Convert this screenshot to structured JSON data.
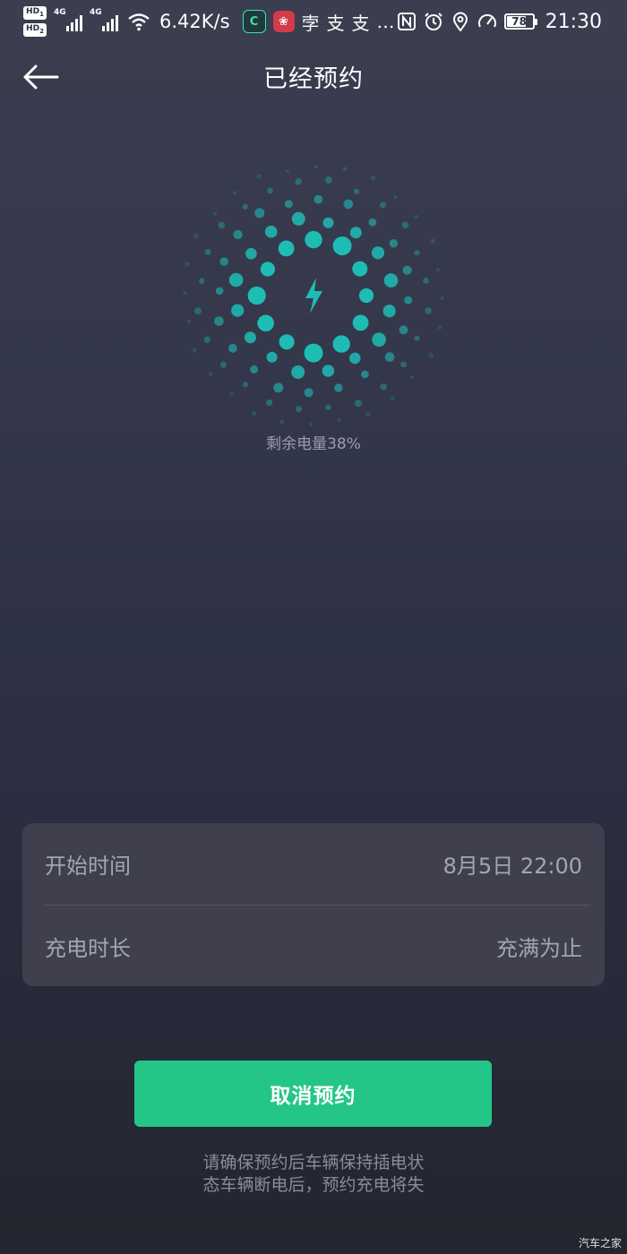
{
  "status_bar": {
    "hd1": "HD",
    "hd1_sub": "1",
    "hd2": "HD",
    "hd2_sub": "2",
    "sim1_tag": "4G",
    "sim2_tag": "4G",
    "net_speed": "6.42K/s",
    "app_glyphs": [
      "孛",
      "支",
      "支"
    ],
    "more": "…",
    "battery_level": "78",
    "battery_fraction": 0.78,
    "time": "21:30"
  },
  "header": {
    "title": "已经预约",
    "back_icon": "arrow-left-icon"
  },
  "charge": {
    "remaining_text": "剩余电量38%",
    "accent_color": "#1dbdb6",
    "icon": "lightning-bolt-icon"
  },
  "schedule": {
    "rows": [
      {
        "label": "开始时间",
        "value": "8月5日 22:00"
      },
      {
        "label": "充电时长",
        "value": "充满为止"
      }
    ]
  },
  "actions": {
    "cancel_label": "取消预约",
    "cancel_color": "#24c688"
  },
  "notice": {
    "line1": "请确保预约后车辆保持插电状",
    "line2": "态车辆断电后，预约充电将失"
  },
  "watermark": "汽车之家"
}
